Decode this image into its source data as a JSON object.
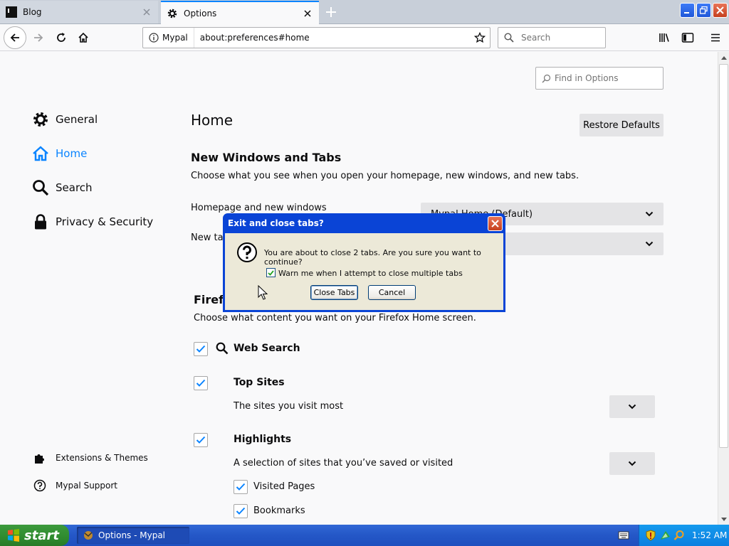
{
  "tabs": [
    {
      "title": "Blog"
    },
    {
      "title": "Options"
    }
  ],
  "navbar": {
    "identity_label": "Mypal",
    "url": "about:preferences#home",
    "search_placeholder": "Search"
  },
  "sidebar": {
    "categories": [
      {
        "label": "General"
      },
      {
        "label": "Home"
      },
      {
        "label": "Search"
      },
      {
        "label": "Privacy & Security"
      }
    ],
    "footer_links": [
      {
        "label": "Extensions & Themes"
      },
      {
        "label": "Mypal Support"
      }
    ]
  },
  "main": {
    "find_placeholder": "Find in Options",
    "heading": "Home",
    "restore_label": "Restore Defaults",
    "new_windows": {
      "title": "New Windows and Tabs",
      "description": "Choose what you see when you open your homepage, new windows, and new tabs.",
      "homepage_label": "Homepage and new windows",
      "homepage_value": "Mypal Home (Default)",
      "newtab_label": "New tabs",
      "newtab_value": ""
    },
    "firefox_home": {
      "title": "Firefox Home Content",
      "description": "Choose what content you want on your Firefox Home screen.",
      "options": [
        {
          "label": "Web Search",
          "checked": true
        },
        {
          "label": "Top Sites",
          "description": "The sites you visit most",
          "checked": true
        },
        {
          "label": "Highlights",
          "description": "A selection of sites that you’ve saved or visited",
          "checked": true
        }
      ],
      "sub_options": [
        {
          "label": "Visited Pages",
          "checked": true
        },
        {
          "label": "Bookmarks",
          "checked": true
        }
      ]
    }
  },
  "dialog": {
    "title": "Exit and close tabs?",
    "message": "You are about to close 2 tabs. Are you sure you want to continue?",
    "warn_label": "Warn me when I attempt to close multiple tabs",
    "warn_checked": true,
    "close_tabs_label": "Close Tabs",
    "cancel_label": "Cancel"
  },
  "taskbar": {
    "start_label": "start",
    "task_label": "Options - Mypal",
    "clock": "1:52 AM"
  },
  "colors": {
    "accent": "#0a84ff",
    "xp_blue": "#2457c7",
    "xp_green": "#2f8b2f"
  }
}
